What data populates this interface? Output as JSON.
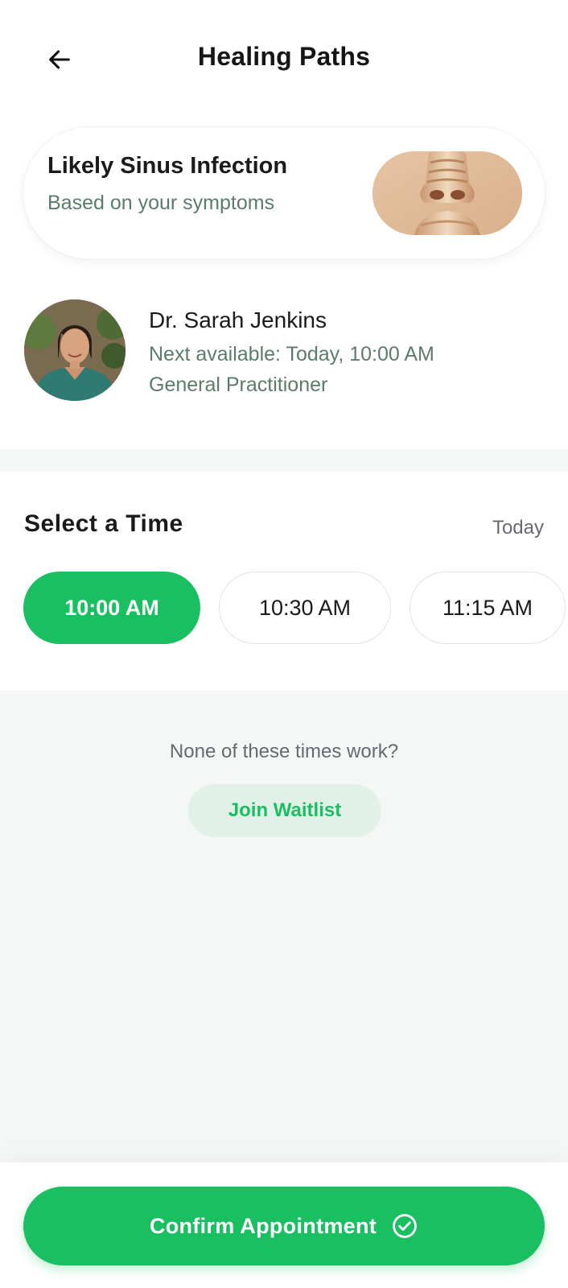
{
  "header": {
    "title": "Healing Paths",
    "back_icon": "arrow-left-icon"
  },
  "diagnosis": {
    "title": "Likely Sinus Infection",
    "subtitle": "Based on your symptoms",
    "image": "nose-illustration"
  },
  "doctor": {
    "name": "Dr. Sarah Jenkins",
    "next_available": "Next available: Today, 10:00 AM",
    "role": "General Practitioner",
    "avatar": "doctor-portrait"
  },
  "time_selection": {
    "title": "Select a Time",
    "day": "Today",
    "slots": [
      {
        "label": "10:00 AM",
        "selected": true
      },
      {
        "label": "10:30 AM",
        "selected": false
      },
      {
        "label": "11:15 AM",
        "selected": false
      }
    ]
  },
  "waitlist": {
    "prompt": "None of these times work?",
    "button_label": "Join Waitlist"
  },
  "footer": {
    "confirm_label": "Confirm Appointment",
    "confirm_icon": "check-circle-icon"
  },
  "colors": {
    "accent": "#1abf61",
    "accent_soft": "#e2f1e8",
    "muted_green": "#5c7c6b",
    "background": "#f5f7f6"
  }
}
